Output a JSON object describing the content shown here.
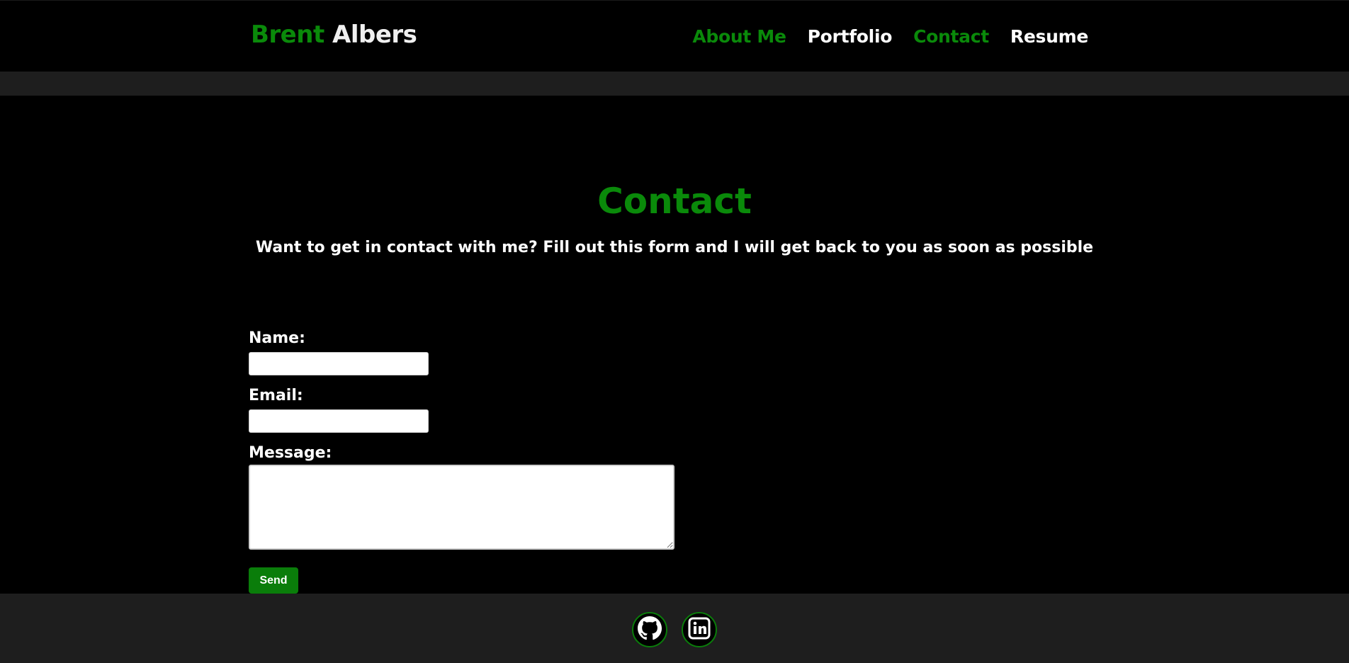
{
  "brand": {
    "first": "Brent",
    "last": "Albers"
  },
  "nav": {
    "items": [
      {
        "label": "About Me",
        "color": "green"
      },
      {
        "label": "Portfolio",
        "color": "white"
      },
      {
        "label": "Contact",
        "color": "green"
      },
      {
        "label": "Resume",
        "color": "white"
      }
    ]
  },
  "main": {
    "title": "Contact",
    "subtitle": "Want to get in contact with me? Fill out this form and I will get back to you as soon as possible"
  },
  "form": {
    "name_label": "Name:",
    "name_value": "",
    "email_label": "Email:",
    "email_value": "",
    "message_label": "Message:",
    "message_value": "",
    "send_label": "Send"
  },
  "footer": {
    "icons": [
      "github-icon",
      "linkedin-icon"
    ]
  },
  "colors": {
    "accent": "#0a8a0a",
    "background": "#000000",
    "bar": "#1e1e1e",
    "text": "#ffffff"
  }
}
